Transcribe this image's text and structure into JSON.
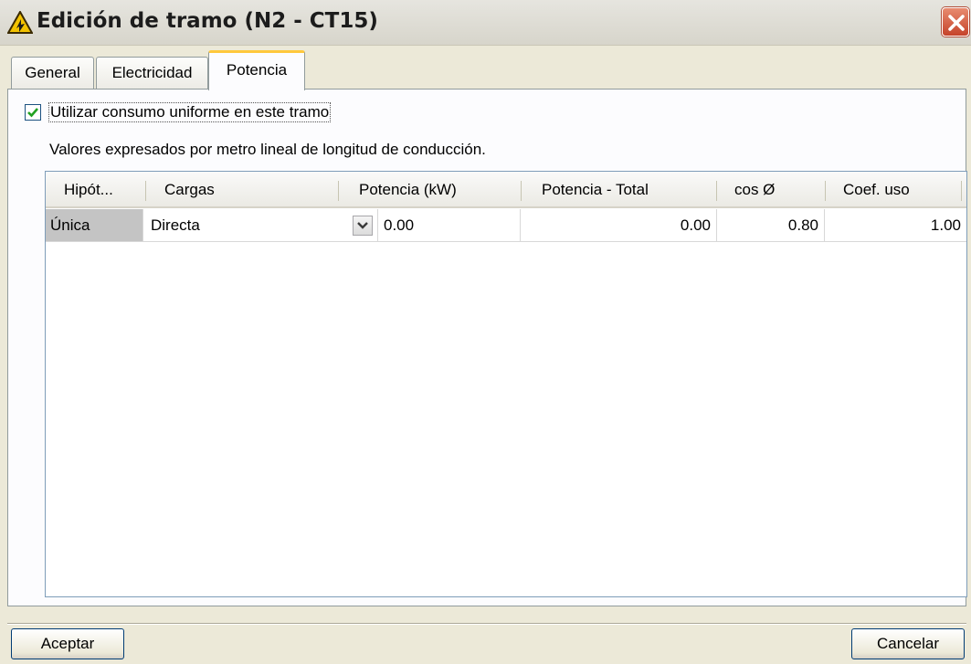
{
  "window": {
    "title": "Edición de tramo (N2 - CT15)"
  },
  "tabs": [
    {
      "label": "General"
    },
    {
      "label": "Electricidad"
    },
    {
      "label": "Potencia"
    }
  ],
  "options": {
    "uniform_label": "Utilizar consumo uniforme en este tramo",
    "uniform_checked": true
  },
  "note": "Valores expresados por metro lineal de longitud de conducción.",
  "table": {
    "columns": [
      "Hipót...",
      "Cargas",
      "Potencia (kW)",
      "Potencia - Total",
      "cos Ø",
      "Coef. uso"
    ],
    "rows": [
      {
        "hipotesis": "Única",
        "cargas": "Directa",
        "potencia": "0.00",
        "total": "0.00",
        "cos": "0.80",
        "coef": "1.00"
      }
    ]
  },
  "buttons": {
    "accept": "Aceptar",
    "cancel": "Cancelar"
  },
  "colors": {
    "active_tab_accent": "#ffc83c",
    "close_button": "#c5432a",
    "checkmark": "#21a121"
  }
}
